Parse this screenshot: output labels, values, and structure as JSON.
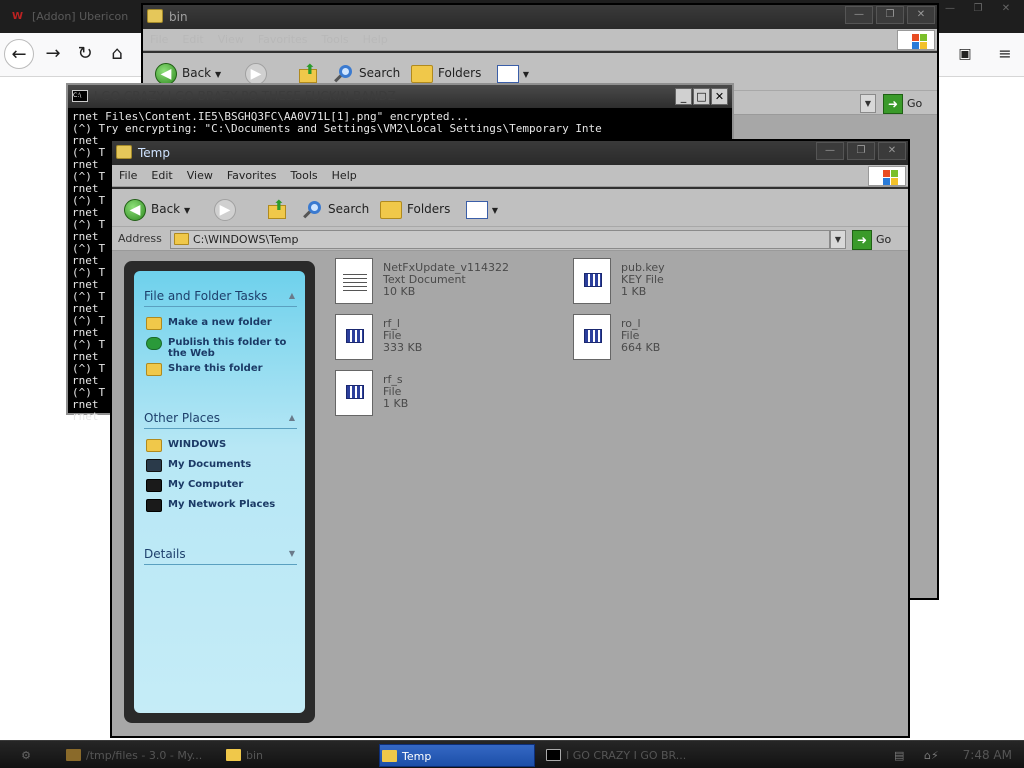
{
  "firefox": {
    "tab_title": "[Addon] Ubericon",
    "win_controls": [
      "—",
      "❐",
      "✕"
    ]
  },
  "bin_window": {
    "title": "bin",
    "menu": [
      "File",
      "Edit",
      "View",
      "Favorites",
      "Tools",
      "Help"
    ],
    "toolbar": {
      "back": "Back",
      "search": "Search",
      "folders": "Folders"
    },
    "go": "Go"
  },
  "cmd_window": {
    "title": "I GO CRAZY I GO BRAZY PO THESE FUCKIN BANDZ",
    "line1": "rnet Files\\Content.IE5\\BSGHQ3FC\\AA0V71L[1].png\" encrypted...",
    "line2": "(^) Try encrypting: \"C:\\Documents and Settings\\VM2\\Local Settings\\Temporary Inte",
    "side_lines": "rnet\n(^) T\nrnet\n(^) T\nrnet\n(^) T\nrnet\n(^) T\nrnet\n(^) T\nrnet\n(^) T\nrnet\n(^) T\nrnet\n(^) T\nrnet\n(^) T\nrnet\n(^) T\nrnet\n(^) T\nrnet\nrnet"
  },
  "temp_window": {
    "title": "Temp",
    "menu": [
      "File",
      "Edit",
      "View",
      "Favorites",
      "Tools",
      "Help"
    ],
    "toolbar": {
      "back": "Back",
      "search": "Search",
      "folders": "Folders"
    },
    "address_label": "Address",
    "address_value": "C:\\WINDOWS\\Temp",
    "go": "Go",
    "tasks": {
      "file_folder_header": "File and Folder Tasks",
      "file_folder_items": [
        "Make a new folder",
        "Publish this folder to the Web",
        "Share this folder"
      ],
      "other_places_header": "Other Places",
      "other_places_items": [
        "WINDOWS",
        "My Documents",
        "My Computer",
        "My Network Places"
      ],
      "details_header": "Details"
    },
    "files": [
      {
        "name": "NetFxUpdate_v114322",
        "type": "Text Document",
        "size": "10 KB"
      },
      {
        "name": "pub.key",
        "type": "KEY File",
        "size": "1 KB"
      },
      {
        "name": "rf_l",
        "type": "File",
        "size": "333 KB"
      },
      {
        "name": "ro_l",
        "type": "File",
        "size": "664 KB"
      },
      {
        "name": "rf_s",
        "type": "File",
        "size": "1 KB"
      }
    ]
  },
  "taskbar": {
    "items": [
      "/tmp/files - 3.0 - My...",
      "bin",
      "Temp",
      "I GO CRAZY I GO BR..."
    ],
    "clock": "7:48 AM"
  }
}
